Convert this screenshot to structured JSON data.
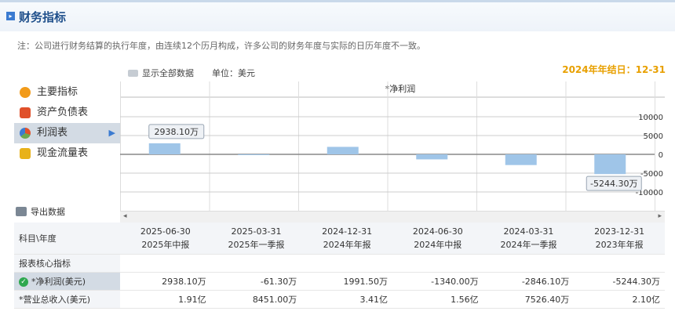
{
  "header": {
    "title": "财务指标"
  },
  "note": "注：公司进行财务结算的执行年度，由连续12个历月构成，许多公司的财务年度与实际的日历年度不一致。",
  "fiscal_year_end": "2024年年结日：12-31",
  "toolbar": {
    "show_all": "显示全部数据",
    "unit": "单位：美元"
  },
  "menu": [
    {
      "label": "主要指标",
      "icon": "sun-icon",
      "color": "#f29b1a"
    },
    {
      "label": "资产负债表",
      "icon": "book-icon",
      "color": "#e0502a"
    },
    {
      "label": "利润表",
      "icon": "pie-chart-icon",
      "color": "#6aa84f",
      "active": true
    },
    {
      "label": "现金流量表",
      "icon": "coins-icon",
      "color": "#e8b21a"
    }
  ],
  "export_label": "导出数据",
  "chart_data": {
    "type": "bar",
    "title": "*净利润",
    "categories": [
      "2025-06-30",
      "2025-03-31",
      "2024-12-31",
      "2024-06-30",
      "2024-03-31",
      "2023-12-31"
    ],
    "values": [
      2938.1,
      -61.3,
      1991.5,
      -1340.0,
      -2846.1,
      -5244.3
    ],
    "ylim": [
      -12000,
      12000
    ],
    "yticks": [
      10000,
      5000,
      0,
      -5000,
      -10000
    ],
    "annotations": [
      {
        "index": 0,
        "text": "2938.10万"
      },
      {
        "index": 5,
        "text": "-5244.30万"
      }
    ],
    "bar_color": "#9fc5e8"
  },
  "table": {
    "header_label": "科目\\年度",
    "columns": [
      {
        "date": "2025-06-30",
        "period": "2025年中报"
      },
      {
        "date": "2025-03-31",
        "period": "2025年一季报"
      },
      {
        "date": "2024-12-31",
        "period": "2024年年报"
      },
      {
        "date": "2024-06-30",
        "period": "2024年中报"
      },
      {
        "date": "2024-03-31",
        "period": "2024年一季报"
      },
      {
        "date": "2023-12-31",
        "period": "2023年年报"
      }
    ],
    "section_label": "报表核心指标",
    "rows": [
      {
        "label": "*净利润(美元)",
        "values": [
          "2938.10万",
          "-61.30万",
          "1991.50万",
          "-1340.00万",
          "-2846.10万",
          "-5244.30万"
        ]
      },
      {
        "label": "*营业总收入(美元)",
        "values": [
          "1.91亿",
          "8451.00万",
          "3.41亿",
          "1.56亿",
          "7526.40万",
          "2.10亿"
        ]
      }
    ]
  }
}
